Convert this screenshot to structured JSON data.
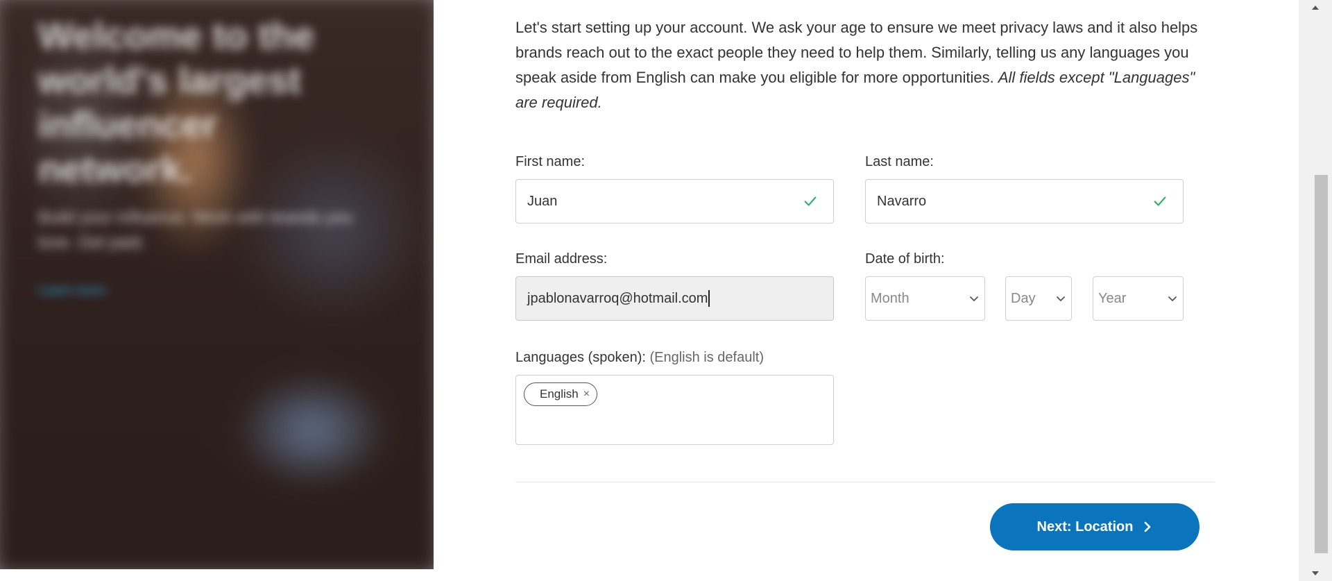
{
  "hero": {
    "title": "Welcome to the world's largest influencer network.",
    "subtitle": "Build your influence. Work with brands you love. Get paid.",
    "link": "Learn more"
  },
  "intro": {
    "text": "Let's start setting up your account. We ask your age to ensure we meet privacy laws and it also helps brands reach out to the exact people they need to help them. Similarly, telling us any languages you speak aside from English can make you eligible for more opportunities.",
    "emphasis": "All fields except \"Languages\" are required."
  },
  "form": {
    "first_name": {
      "label": "First name:",
      "value": "Juan"
    },
    "last_name": {
      "label": "Last name:",
      "value": "Navarro"
    },
    "email": {
      "label": "Email address:",
      "value": "jpablonavarroq@hotmail.com"
    },
    "dob": {
      "label": "Date of birth:",
      "month": "Month",
      "day": "Day",
      "year": "Year"
    },
    "languages": {
      "label": "Languages (spoken):",
      "hint": "(English is default)",
      "tags": [
        "English"
      ],
      "remove_glyph": "×"
    }
  },
  "actions": {
    "next_label": "Next: Location"
  },
  "colors": {
    "accent": "#0a74bd",
    "valid": "#2fb36b"
  },
  "icons": [
    "check-icon",
    "chevron-down-icon",
    "chevron-right-icon"
  ]
}
